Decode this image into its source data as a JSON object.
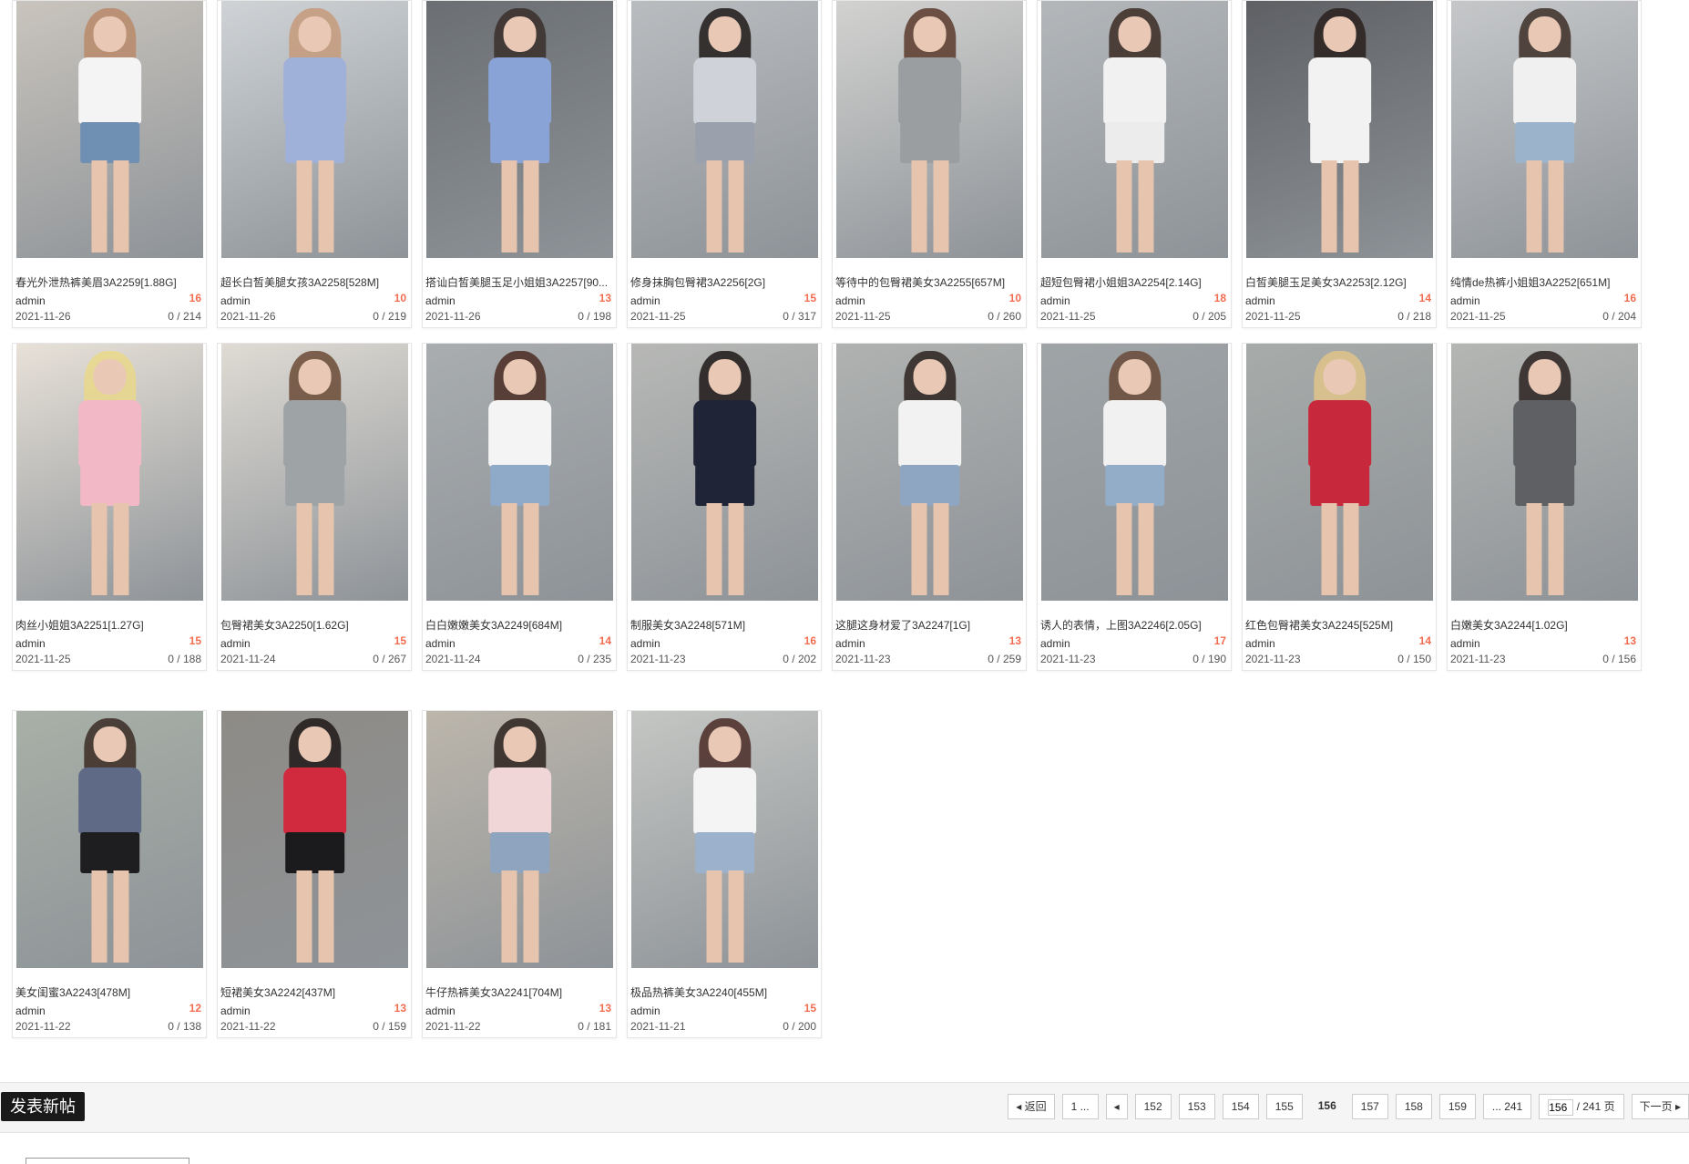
{
  "cards": [
    {
      "title": "春光外泄热裤美眉3A2259[1.88G]",
      "author": "admin",
      "hot": "16",
      "date": "2021-11-26",
      "stats": "0 / 214",
      "colors": {
        "bg": "#c9c4bd",
        "hair": "#b98a6a",
        "top": "#f4f4f4",
        "bottom": "#6f8fb3"
      }
    },
    {
      "title": "超长白皙美腿女孩3A2258[528M]",
      "author": "admin",
      "hot": "10",
      "date": "2021-11-26",
      "stats": "0 / 219",
      "colors": {
        "bg": "#cfd3d6",
        "hair": "#c59a7a",
        "top": "#9fb0d9",
        "bottom": "#9fb0d9"
      }
    },
    {
      "title": "搭讪白皙美腿玉足小姐姐3A2257[90...",
      "author": "admin",
      "hot": "13",
      "date": "2021-11-26",
      "stats": "0 / 198",
      "colors": {
        "bg": "#6b6f73",
        "hair": "#3a2f2a",
        "top": "#8aa3d6",
        "bottom": "#8aa3d6"
      }
    },
    {
      "title": "修身抹胸包臀裙3A2256[2G]",
      "author": "admin",
      "hot": "15",
      "date": "2021-11-25",
      "stats": "0 / 317",
      "colors": {
        "bg": "#b9bcbf",
        "hair": "#1f1a18",
        "top": "#cfd2d8",
        "bottom": "#9aa1ad"
      }
    },
    {
      "title": "等待中的包臀裙美女3A2255[657M]",
      "author": "admin",
      "hot": "10",
      "date": "2021-11-25",
      "stats": "0 / 260",
      "colors": {
        "bg": "#d2d2d0",
        "hair": "#5a3a2a",
        "top": "#9b9ea1",
        "bottom": "#9b9ea1"
      }
    },
    {
      "title": "超短包臀裙小姐姐3A2254[2.14G]",
      "author": "admin",
      "hot": "18",
      "date": "2021-11-25",
      "stats": "0 / 205",
      "colors": {
        "bg": "#b3b7ba",
        "hair": "#3b2a22",
        "top": "#f1f1f1",
        "bottom": "#ececec"
      }
    },
    {
      "title": "白皙美腿玉足美女3A2253[2.12G]",
      "author": "admin",
      "hot": "14",
      "date": "2021-11-25",
      "stats": "0 / 218",
      "colors": {
        "bg": "#5e6064",
        "hair": "#2a211d",
        "top": "#f2f2f2",
        "bottom": "#f2f2f2"
      }
    },
    {
      "title": "纯情de热裤小姐姐3A2252[651M]",
      "author": "admin",
      "hot": "16",
      "date": "2021-11-25",
      "stats": "0 / 204",
      "colors": {
        "bg": "#c5c7c9",
        "hair": "#3d2e27",
        "top": "#f0f0f0",
        "bottom": "#9cb3cc"
      }
    },
    {
      "title": "肉丝小姐姐3A2251[1.27G]",
      "author": "admin",
      "hot": "15",
      "date": "2021-11-25",
      "stats": "0 / 188",
      "colors": {
        "bg": "#e7e1d8",
        "hair": "#e9d88a",
        "top": "#f3b8c5",
        "bottom": "#f3b8c5"
      }
    },
    {
      "title": "包臀裙美女3A2250[1.62G]",
      "author": "admin",
      "hot": "15",
      "date": "2021-11-24",
      "stats": "0 / 267",
      "colors": {
        "bg": "#dfdbd4",
        "hair": "#6b4a36",
        "top": "#9ea3a6",
        "bottom": "#9ea3a6"
      }
    },
    {
      "title": "白白嫩嫩美女3A2249[684M]",
      "author": "admin",
      "hot": "14",
      "date": "2021-11-24",
      "stats": "0 / 235",
      "colors": {
        "bg": "#a9adaf",
        "hair": "#4a2c22",
        "top": "#f4f4f4",
        "bottom": "#8fa9c8"
      }
    },
    {
      "title": "制服美女3A2248[571M]",
      "author": "admin",
      "hot": "16",
      "date": "2021-11-23",
      "stats": "0 / 202",
      "colors": {
        "bg": "#b7b8b6",
        "hair": "#1d1816",
        "top": "#1f2536",
        "bottom": "#1f2536"
      }
    },
    {
      "title": "这腿这身材爱了3A2247[1G]",
      "author": "admin",
      "hot": "13",
      "date": "2021-11-23",
      "stats": "0 / 259",
      "colors": {
        "bg": "#b0b2b1",
        "hair": "#2b221e",
        "top": "#f2f2f2",
        "bottom": "#8ea6c2"
      }
    },
    {
      "title": "诱人的表情，上图3A2246[2.05G]",
      "author": "admin",
      "hot": "17",
      "date": "2021-11-23",
      "stats": "0 / 190",
      "colors": {
        "bg": "#9fa4a7",
        "hair": "#6a4a38",
        "top": "#f1f1f1",
        "bottom": "#93adc9"
      }
    },
    {
      "title": "红色包臀裙美女3A2245[525M]",
      "author": "admin",
      "hot": "14",
      "date": "2021-11-23",
      "stats": "0 / 150",
      "colors": {
        "bg": "#a7aba9",
        "hair": "#e1c48a",
        "top": "#c8283c",
        "bottom": "#c8283c"
      }
    },
    {
      "title": "白嫩美女3A2244[1.02G]",
      "author": "admin",
      "hot": "13",
      "date": "2021-11-23",
      "stats": "0 / 156",
      "colors": {
        "bg": "#b4b6b3",
        "hair": "#2a2220",
        "top": "#5f6063",
        "bottom": "#5f6063"
      }
    },
    {
      "title": "美女闺蜜3A2243[478M]",
      "author": "admin",
      "hot": "12",
      "date": "2021-11-22",
      "stats": "0 / 138",
      "colors": {
        "bg": "#a8b0a7",
        "hair": "#3b2b24",
        "top": "#5e6a86",
        "bottom": "#1e1e20"
      }
    },
    {
      "title": "短裙美女3A2242[437M]",
      "author": "admin",
      "hot": "13",
      "date": "2021-11-22",
      "stats": "0 / 159",
      "colors": {
        "bg": "#8e8b86",
        "hair": "#1f1917",
        "top": "#d12a3f",
        "bottom": "#1b1b1d"
      }
    },
    {
      "title": "牛仔热裤美女3A2241[704M]",
      "author": "admin",
      "hot": "13",
      "date": "2021-11-22",
      "stats": "0 / 181",
      "colors": {
        "bg": "#bcb6ab",
        "hair": "#2b211d",
        "top": "#f0d6d6",
        "bottom": "#8ea4bf"
      }
    },
    {
      "title": "极品热裤美女3A2240[455M]",
      "author": "admin",
      "hot": "15",
      "date": "2021-11-21",
      "stats": "0 / 200",
      "colors": {
        "bg": "#c4c6c3",
        "hair": "#4a2a26",
        "top": "#f4f4f4",
        "bottom": "#9cb2cc"
      }
    }
  ],
  "footer": {
    "new_post_label": "发表新帖",
    "pagination": {
      "back_label": "返回",
      "first_label": "1 ...",
      "pages": [
        "152",
        "153",
        "154",
        "155",
        "156",
        "157",
        "158",
        "159"
      ],
      "current": "156",
      "last_label": "... 241",
      "jump_value": "156",
      "total_label": "/ 241 页",
      "next_label": "下一页"
    }
  }
}
